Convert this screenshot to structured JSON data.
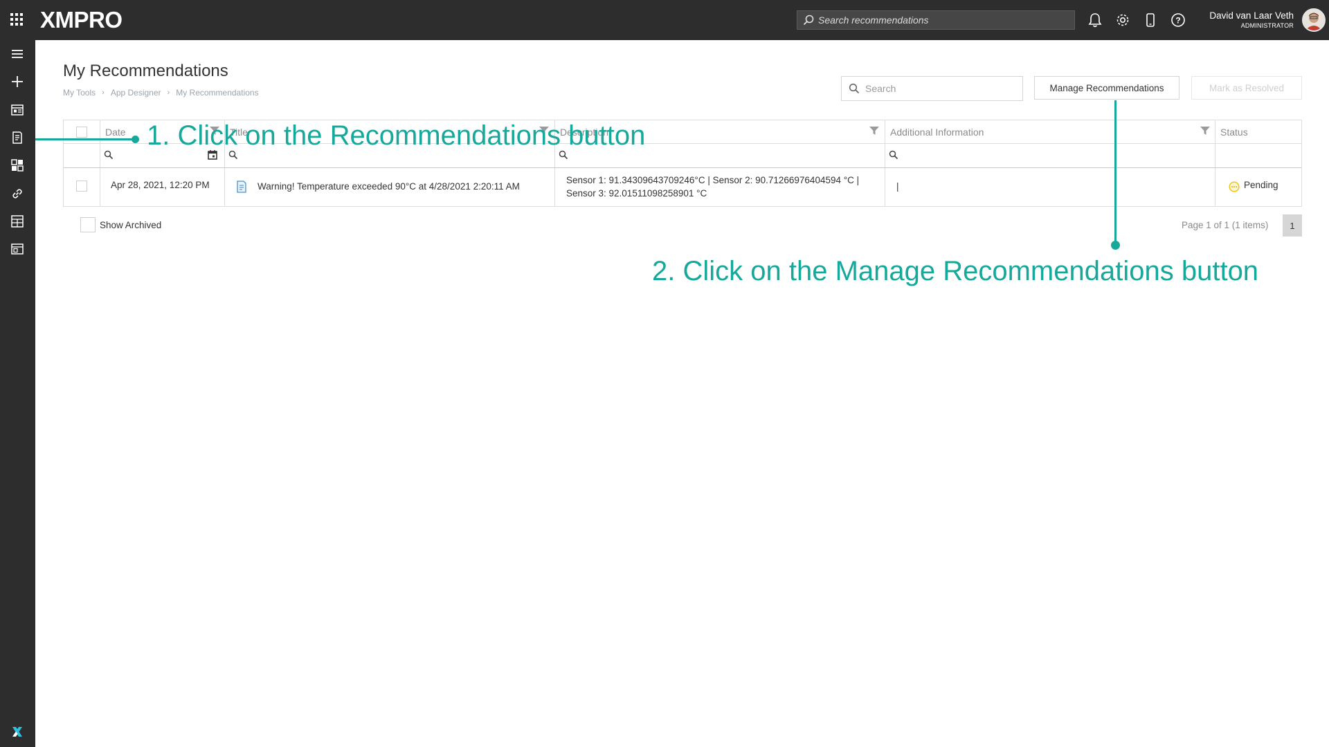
{
  "topbar": {
    "logo": "XMPRO",
    "search_placeholder": "Search recommendations",
    "user_name": "David van Laar Veth",
    "user_role": "ADMINISTRATOR"
  },
  "page": {
    "title": "My Recommendations",
    "breadcrumb": [
      "My Tools",
      "App Designer",
      "My Recommendations"
    ]
  },
  "toolbar": {
    "search_placeholder": "Search",
    "manage_label": "Manage Recommendations",
    "resolve_label": "Mark as Resolved"
  },
  "grid": {
    "columns": [
      "Date",
      "Title",
      "Description",
      "Additional Information",
      "Status"
    ],
    "rows": [
      {
        "date": "Apr 28, 2021, 12:20 PM",
        "title": "Warning! Temperature exceeded 90°C at 4/28/2021 2:20:11 AM",
        "description_line1": "Sensor 1: 91.34309643709246°C | Sensor 2: 90.71266976404594 °C |",
        "description_line2": "Sensor 3: 92.01511098258901 °C",
        "additional": "|",
        "status": "Pending"
      }
    ]
  },
  "footer": {
    "show_archived": "Show Archived",
    "pager_info": "Page 1 of 1 (1 items)",
    "page_number": "1"
  },
  "annotations": {
    "step1": "1. Click on the Recommendations button",
    "step2": "2. Click on the Manage Recommendations button"
  },
  "colors": {
    "topbar_bg": "#2d2d2d",
    "annotation": "#16a89a",
    "pending": "#f2c318"
  }
}
